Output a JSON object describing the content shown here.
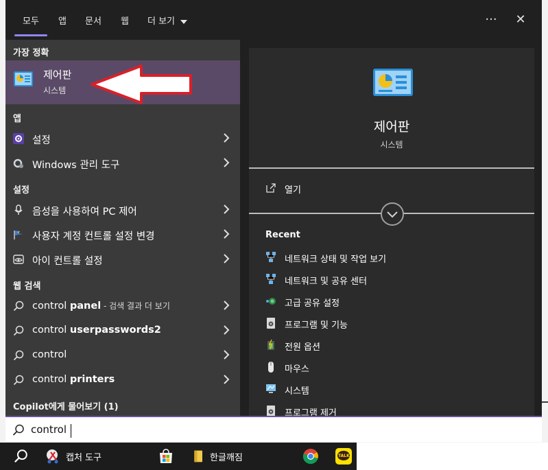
{
  "tabs": [
    {
      "label": "모두",
      "active": true
    },
    {
      "label": "앱"
    },
    {
      "label": "문서"
    },
    {
      "label": "웹"
    },
    {
      "label": "더 보기"
    }
  ],
  "topbar": {
    "more_glyph": "···",
    "close_glyph": "✕"
  },
  "left": {
    "best_match_header": "가장 정확",
    "best_match": {
      "title": "제어판",
      "subtitle": "시스템",
      "icon": "control-panel-icon"
    },
    "apps_header": "앱",
    "apps": [
      {
        "label": "설정",
        "icon": "gear-icon"
      },
      {
        "label": "Windows 관리 도구",
        "icon": "gear-icon"
      }
    ],
    "settings_header": "설정",
    "settings": [
      {
        "label": "음성을 사용하여 PC 제어",
        "icon": "microphone-icon"
      },
      {
        "label": "사용자 계정 컨트롤 설정 변경",
        "icon": "flag-icon"
      },
      {
        "label": "아이 컨트롤 설정",
        "icon": "eye-icon"
      }
    ],
    "web_header": "웹 검색",
    "web": [
      {
        "prefix": "control ",
        "bold": "panel",
        "suffix": " - 검색 결과 더 보기"
      },
      {
        "prefix": "control ",
        "bold": "userpasswords2",
        "suffix": ""
      },
      {
        "prefix": "control",
        "bold": "",
        "suffix": ""
      },
      {
        "prefix": "control ",
        "bold": "printers",
        "suffix": ""
      }
    ],
    "copilot_header": "Copilot에게 물어보기 (1)"
  },
  "right": {
    "title": "제어판",
    "subtitle": "시스템",
    "open_label": "열기",
    "recent_header": "Recent",
    "recent": [
      {
        "label": "네트워크 상태 및 작업 보기",
        "icon": "network-icon"
      },
      {
        "label": "네트워크 및 공유 센터",
        "icon": "network-icon"
      },
      {
        "label": "고급 공유 설정",
        "icon": "sharing-icon"
      },
      {
        "label": "프로그램 및 기능",
        "icon": "programs-icon"
      },
      {
        "label": "전원 옵션",
        "icon": "power-icon"
      },
      {
        "label": "마우스",
        "icon": "mouse-icon"
      },
      {
        "label": "시스템",
        "icon": "system-icon"
      },
      {
        "label": "프로그램 제거",
        "icon": "programs-icon"
      }
    ]
  },
  "search": {
    "value": "control"
  },
  "taskbar": {
    "items": [
      {
        "label": "",
        "icon": "search-icon"
      },
      {
        "label": "캡처 도구",
        "icon": "snipping-tool-icon"
      },
      {
        "label": "",
        "icon": "store-icon"
      },
      {
        "label": "한글깨짐",
        "icon": "folder-icon"
      },
      {
        "label": "",
        "icon": "chrome-icon"
      },
      {
        "label": "",
        "icon": "kakaotalk-icon"
      }
    ],
    "kakao_text": "TALK"
  },
  "colors": {
    "accent": "#8f86ff",
    "selected_bg": "#5a4a67",
    "arrow_red": "#d8202a"
  }
}
